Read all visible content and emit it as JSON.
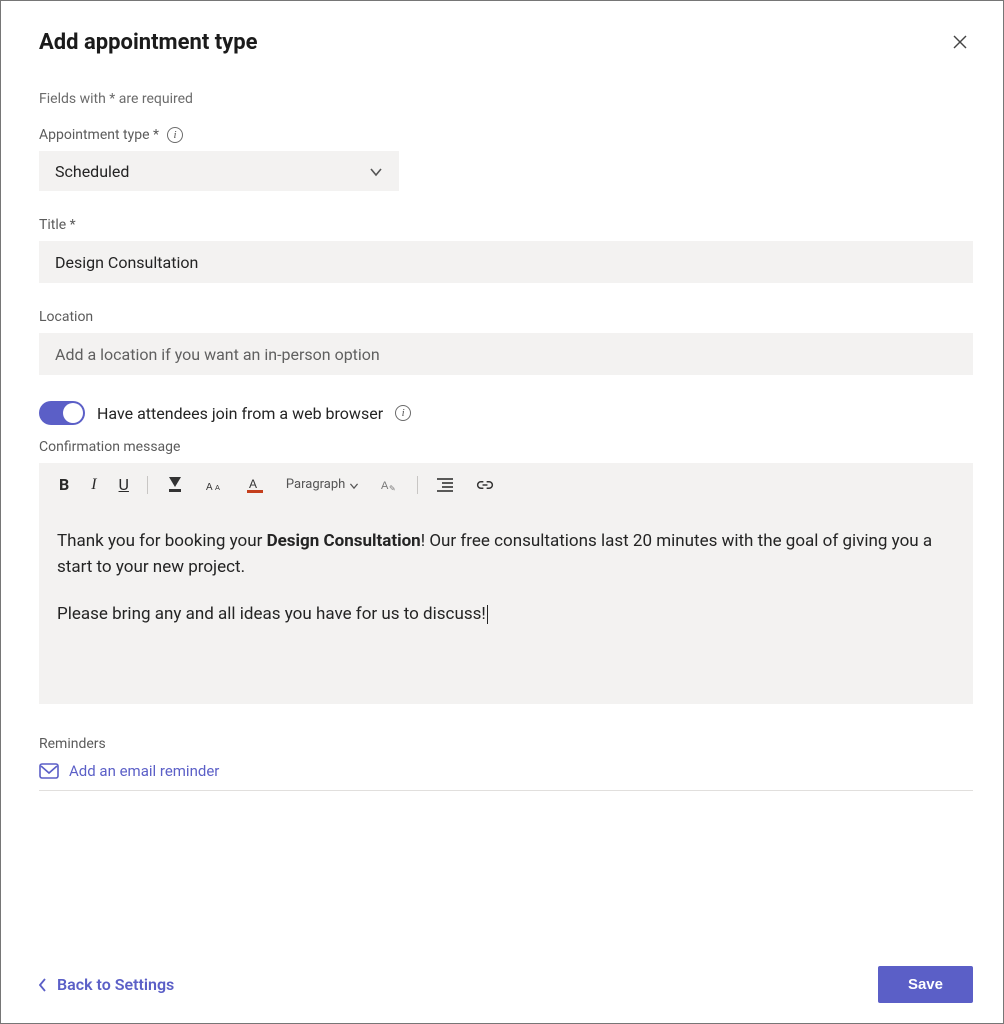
{
  "header": {
    "title": "Add appointment type"
  },
  "hint": "Fields with * are required",
  "fields": {
    "appointment_type": {
      "label": "Appointment type *",
      "value": "Scheduled"
    },
    "title": {
      "label": "Title *",
      "value": "Design Consultation"
    },
    "location": {
      "label": "Location",
      "placeholder": "Add a location if you want an in-person option",
      "value": ""
    }
  },
  "web_join": {
    "label": "Have attendees join from a web browser",
    "enabled": true
  },
  "confirmation": {
    "label": "Confirmation message",
    "toolbar": {
      "paragraph_label": "Paragraph"
    },
    "message": {
      "line1_pre": "Thank you for booking your ",
      "line1_bold": "Design Consultation",
      "line1_post": "! Our free consultations last 20 minutes with the goal of giving you a start to your new project.",
      "line2": "Please bring any and all ideas you have for us to discuss!"
    }
  },
  "reminders": {
    "label": "Reminders",
    "add_label": "Add an email reminder"
  },
  "footer": {
    "back_label": "Back to Settings",
    "save_label": "Save"
  },
  "colors": {
    "accent": "#5b5fc7",
    "field_bg": "#f3f2f1"
  }
}
